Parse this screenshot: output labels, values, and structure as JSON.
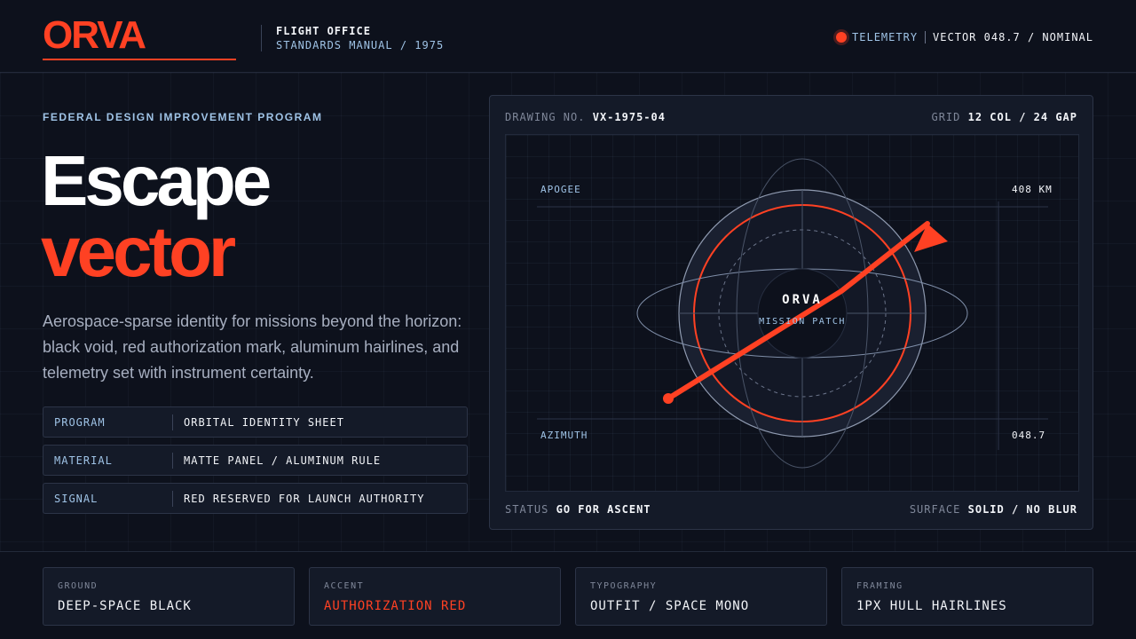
{
  "header": {
    "logo": "ORVA",
    "office_title": "FLIGHT OFFICE",
    "office_sub": "STANDARDS MANUAL / 1975",
    "telemetry_label": "TELEMETRY",
    "telemetry_value": "VECTOR 048.7 / NOMINAL"
  },
  "hero": {
    "eyebrow": "FEDERAL DESIGN IMPROVEMENT PROGRAM",
    "title_line1": "Escape",
    "title_line2": "vector",
    "description": "Aerospace-sparse identity for missions beyond the horizon: black void, red authorization mark, aluminum hairlines, and telemetry set with instrument certainty."
  },
  "specs": [
    {
      "key": "PROGRAM",
      "value": "ORBITAL IDENTITY SHEET"
    },
    {
      "key": "MATERIAL",
      "value": "MATTE PANEL / ALUMINUM RULE"
    },
    {
      "key": "SIGNAL",
      "value": "RED RESERVED FOR LAUNCH AUTHORITY"
    }
  ],
  "drawing": {
    "drawing_no_label": "DRAWING NO.",
    "drawing_no_value": "VX-1975-04",
    "grid_label": "GRID",
    "grid_value": "12 COL / 24 GAP",
    "status_label": "STATUS",
    "status_value": "GO FOR ASCENT",
    "surface_label": "SURFACE",
    "surface_value": "SOLID / NO BLUR",
    "apogee_label": "APOGEE",
    "apogee_value": "408 KM",
    "azimuth_label": "AZIMUTH",
    "azimuth_value": "048.7",
    "patch_title": "ORVA",
    "patch_sub": "MISSION PATCH"
  },
  "footer": [
    {
      "label": "GROUND",
      "value": "DEEP-SPACE BLACK"
    },
    {
      "label": "ACCENT",
      "value": "AUTHORIZATION RED"
    },
    {
      "label": "TYPOGRAPHY",
      "value": "OUTFIT / SPACE MONO"
    },
    {
      "label": "FRAMING",
      "value": "1PX HULL HAIRLINES"
    }
  ],
  "colors": {
    "background": "#0d111c",
    "accent": "#ff4123",
    "rule": "#2c3447",
    "ice": "#9fc3e6"
  },
  "icons": {
    "telemetry": "status-dot-icon",
    "trajectory": "arrow-icon"
  }
}
